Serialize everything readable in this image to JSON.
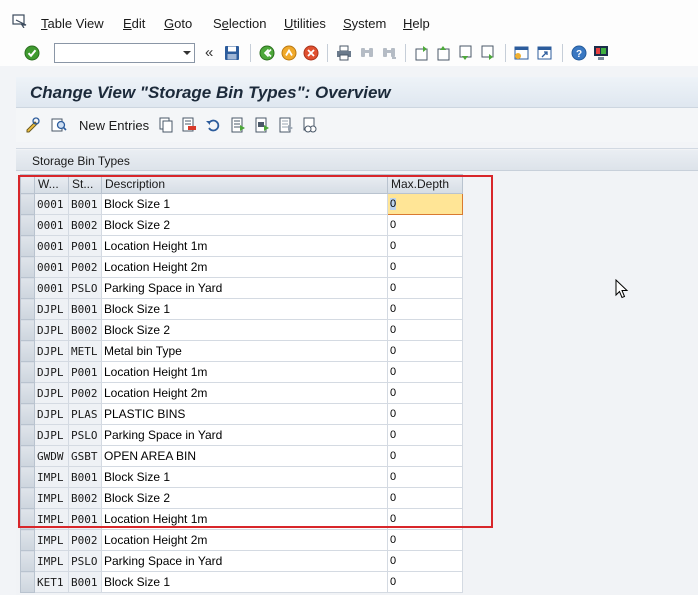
{
  "menu": {
    "items": [
      {
        "name": "table-view",
        "label": "Table View",
        "underline": "T",
        "rest": "able View"
      },
      {
        "name": "edit",
        "label": "Edit",
        "underline": "E",
        "rest": "dit"
      },
      {
        "name": "goto",
        "label": "Goto",
        "underline": "G",
        "rest": "oto"
      },
      {
        "name": "selection",
        "label": "Selection",
        "underline": "S",
        "rest": "election"
      },
      {
        "name": "utilities",
        "label": "Utilities",
        "underline": "U",
        "rest": "tilities"
      },
      {
        "name": "system",
        "label": "System",
        "underline": "S",
        "rest": "ystem"
      },
      {
        "name": "help",
        "label": "Help",
        "underline": "H",
        "rest": "elp"
      }
    ]
  },
  "toolbar": {
    "command_field_value": "",
    "back_label": "«"
  },
  "title": "Change View \"Storage Bin Types\": Overview",
  "app_toolbar": {
    "new_entries_label": "New Entries"
  },
  "section": {
    "label": "Storage Bin Types"
  },
  "table": {
    "columns": [
      "W...",
      "St...",
      "Description",
      "Max.Depth"
    ],
    "rows": [
      {
        "wh": "0001",
        "st": "B001",
        "desc": "Block Size 1",
        "depth": "0"
      },
      {
        "wh": "0001",
        "st": "B002",
        "desc": "Block Size 2",
        "depth": "0"
      },
      {
        "wh": "0001",
        "st": "P001",
        "desc": "Location Height 1m",
        "depth": "0"
      },
      {
        "wh": "0001",
        "st": "P002",
        "desc": "Location Height 2m",
        "depth": "0"
      },
      {
        "wh": "0001",
        "st": "PSLO",
        "desc": "Parking Space in Yard",
        "depth": "0"
      },
      {
        "wh": "DJPL",
        "st": "B001",
        "desc": "Block Size 1",
        "depth": "0"
      },
      {
        "wh": "DJPL",
        "st": "B002",
        "desc": "Block Size 2",
        "depth": "0"
      },
      {
        "wh": "DJPL",
        "st": "METL",
        "desc": "Metal bin Type",
        "depth": "0"
      },
      {
        "wh": "DJPL",
        "st": "P001",
        "desc": "Location Height 1m",
        "depth": "0"
      },
      {
        "wh": "DJPL",
        "st": "P002",
        "desc": "Location Height 2m",
        "depth": "0"
      },
      {
        "wh": "DJPL",
        "st": "PLAS",
        "desc": "PLASTIC BINS",
        "depth": "0"
      },
      {
        "wh": "DJPL",
        "st": "PSLO",
        "desc": "Parking Space in Yard",
        "depth": "0"
      },
      {
        "wh": "GWDW",
        "st": "GSBT",
        "desc": "OPEN AREA BIN",
        "depth": "0"
      },
      {
        "wh": "IMPL",
        "st": "B001",
        "desc": "Block Size 1",
        "depth": "0"
      },
      {
        "wh": "IMPL",
        "st": "B002",
        "desc": "Block Size 2",
        "depth": "0"
      },
      {
        "wh": "IMPL",
        "st": "P001",
        "desc": "Location Height 1m",
        "depth": "0"
      },
      {
        "wh": "IMPL",
        "st": "P002",
        "desc": "Location Height 2m",
        "depth": "0"
      },
      {
        "wh": "IMPL",
        "st": "PSLO",
        "desc": "Parking Space in Yard",
        "depth": "0"
      },
      {
        "wh": "KET1",
        "st": "B001",
        "desc": "Block Size 1",
        "depth": "0"
      }
    ]
  },
  "colors": {
    "highlight_frame": "#d8262a",
    "active_cell": "#ffe596"
  }
}
